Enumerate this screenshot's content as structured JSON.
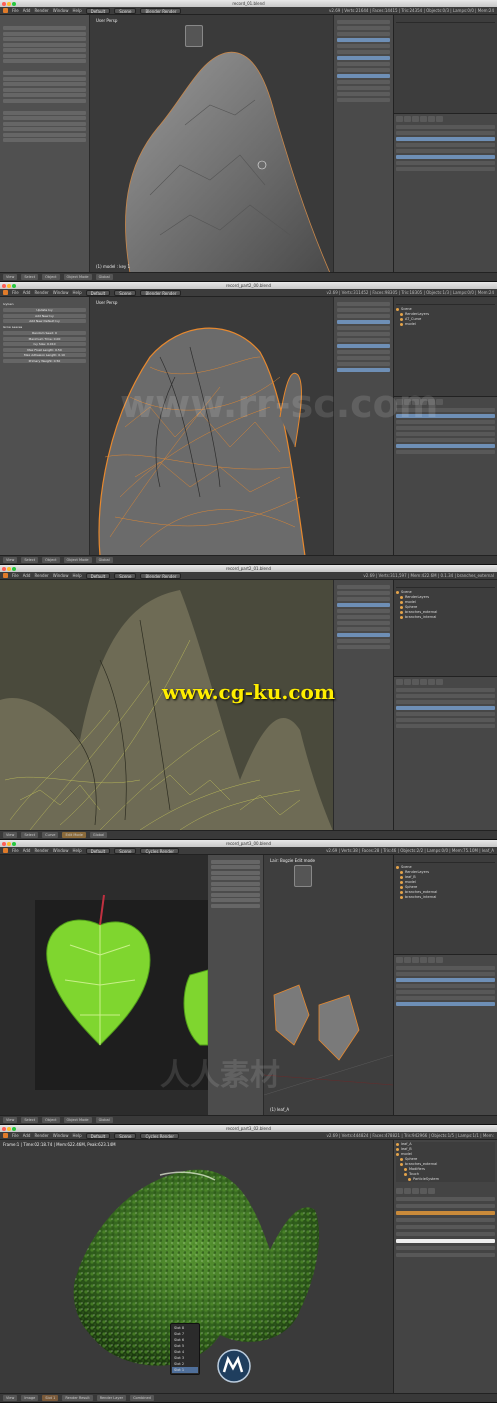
{
  "panels": [
    {
      "title": "record_01.blend",
      "menu": [
        "File",
        "Add",
        "Render",
        "Window",
        "Help"
      ],
      "layout": "Default",
      "scene": "Scene",
      "engine": "Blender Render",
      "stats": "v2.69 | Verts:21644 | Faces:14415 | Tris:24354 | Objects:0/3 | Lamps:0/0 | Mem:24",
      "viewport_label": "User Persp",
      "viewport_foot": "(1) model : key 1",
      "status": [
        "View",
        "Select",
        "Object",
        "Object Mode",
        "Global"
      ]
    },
    {
      "title": "record_part2_00.blend",
      "menu": [
        "File",
        "Add",
        "Render",
        "Window",
        "Help"
      ],
      "layout": "Default",
      "scene": "Scene",
      "engine": "Blender Render",
      "stats": "v2.69 | Verts:311452 | Faces:98305 | Tris:18305 | Objects:1/3 | Lamps:0/0 | Mem:24",
      "viewport_label": "User Persp",
      "viewport_foot": "",
      "outliner": [
        "Scene",
        "RenderLayers",
        "AT_Curve",
        "model"
      ],
      "toolshelf": [
        "IvyGen",
        "Update Ivy",
        "Add New Ivy",
        "Add New Default Ivy",
        "Grow Leaves",
        "Random Seed: 0",
        "Maximum Time: 0.00",
        "Ivy Size: 0.010",
        "Max Float Length: 0.50",
        "Max Adhesion Length: 0.10",
        "Primary Weight: 0.50"
      ],
      "status": [
        "View",
        "Select",
        "Object",
        "Object Mode",
        "Global"
      ]
    },
    {
      "title": "record_part2_01.blend",
      "menu": [
        "File",
        "Add",
        "Render",
        "Window",
        "Help"
      ],
      "layout": "Default",
      "scene": "Scene",
      "engine": "Blender Render",
      "stats": "v2.69 | Verts:311,597 | Mem:422.6M | 0.1.34 | branches_external",
      "viewport_label": "",
      "viewport_foot": "",
      "outliner": [
        "Scene",
        "RenderLayers",
        "model",
        "Sphere",
        "branches_external",
        "branches_internal"
      ],
      "status": [
        "View",
        "Select",
        "Curve",
        "Edit Mode",
        "Global"
      ]
    },
    {
      "title": "record_part3_00.blend",
      "menu": [
        "File",
        "Add",
        "Render",
        "Window",
        "Help"
      ],
      "layout": "Default",
      "scene": "Scene",
      "engine": "Cycles Render",
      "stats": "v2.69 | Verts:38 | Faces:28 | Tris:46 | Objects:2/2 | Lamps:0/0 | Mem:75.10M | leaf_A",
      "viewport_label": "Lair: Bogzie Edit mode",
      "viewport_foot": "(1) leaf_A",
      "outliner": [
        "Scene",
        "RenderLayers",
        "leaf_B",
        "model",
        "Sphere",
        "branches_external",
        "branches_internal"
      ],
      "status": [
        "View",
        "Select",
        "Object",
        "Object Mode",
        "Global"
      ]
    },
    {
      "title": "record_part3_02.blend",
      "menu": [
        "File",
        "Add",
        "Render",
        "Window",
        "Help"
      ],
      "layout": "Default",
      "scene": "Scene",
      "engine": "Cycles Render",
      "stats": "v2.69 | Verts:444824 | Faces:478821 | Tris:942966 | Objects:1/5 | Lamps:1/1 | Mem:",
      "render_info": "Frame:1 | Time:02:18.74 | Mem:622.46M, Peak:623.14M",
      "outliner": [
        "leaf_A",
        "leaf_B",
        "model",
        "Sphere",
        "branches_external",
        "Modifiers",
        "Touch",
        "ParticleSystem"
      ],
      "slots": [
        "Slot 8",
        "Slot 7",
        "Slot 6",
        "Slot 5",
        "Slot 4",
        "Slot 3",
        "Slot 2",
        "Slot 1"
      ],
      "status": [
        "View",
        "Image",
        "Slot 1",
        "Render Result",
        "Render Layer",
        "Combined"
      ]
    }
  ],
  "watermark": "www.cg-ku.com",
  "ghost_brand": "www.rr-sc.com",
  "colors": {
    "accent": "#e07b2a",
    "wire": "#e8892e",
    "leaf": "#7fd62f",
    "ivy": "#3f7a24",
    "watermark": "#ffee00"
  }
}
